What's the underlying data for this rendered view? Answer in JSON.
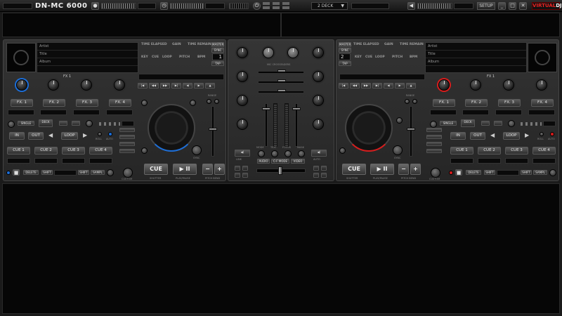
{
  "app": {
    "brand": "DN-MC 6000",
    "deck_select": "2 DECK",
    "setup_label": "SETUP",
    "logo_v": "VIRTUAL",
    "logo_d": "DJ"
  },
  "colors": {
    "left_accent": "#1c6ed8",
    "right_accent": "#d81c1c",
    "bg": "#1a1a1a"
  },
  "deck_left": {
    "track_fields": [
      "Artist",
      "Title",
      "Album"
    ],
    "headers": {
      "time_elapsed": "TIME ELAPSED",
      "gain": "GAIN",
      "time_remain": "TIME REMAIN"
    },
    "subheaders": {
      "key": "KEY",
      "cue": "CUE",
      "loop": "LOOP",
      "pitch": "PITCH",
      "bpm": "BPM"
    },
    "master_label": "MASTER",
    "sync_label": "SYNC",
    "tap_label": "TAP",
    "deck_number": "1",
    "fx_title": "FX 1",
    "fx_buttons": [
      "FX. 1",
      "FX. 2",
      "FX. 3",
      "FX. 4"
    ],
    "single_label": "SINGLE",
    "deck_label": "DECK",
    "in_label": "IN",
    "out_label": "OUT",
    "loop_label": "LOOP",
    "cue_buttons": [
      "CUE 1",
      "CUE 2",
      "CUE 3",
      "CUE 4"
    ],
    "cue_label": "CUE",
    "play_label": "▶ II",
    "shutter_label": "SHUTTER",
    "playpause_label": "PLAY/PAUSE",
    "pitch_bend_label": "PITCH BEND",
    "custom_label": "CUSTOM",
    "range_label": "RANGE",
    "sync_btn": "SYNC",
    "roll_label": "ROLL",
    "auto_label": "AUTO",
    "delete_label": "DELETE",
    "shift_label": "SHIFT",
    "samp_label": "SAMPL"
  },
  "deck_right": {
    "track_fields": [
      "Artist",
      "Title",
      "Album"
    ],
    "headers": {
      "time_elapsed": "TIME ELAPSED",
      "gain": "GAIN",
      "time_remain": "TIME REMAIN"
    },
    "subheaders": {
      "key": "KEY",
      "cue": "CUE",
      "loop": "LOOP",
      "pitch": "PITCH",
      "bpm": "BPM"
    },
    "master_label": "MASTER",
    "sync_label": "SYNC",
    "tap_label": "TAP",
    "deck_number": "2",
    "fx_title": "FX 1",
    "fx_buttons": [
      "FX. 1",
      "FX. 2",
      "FX. 3",
      "FX. 4"
    ],
    "single_label": "SINGLE",
    "deck_label": "DECK",
    "in_label": "IN",
    "out_label": "OUT",
    "loop_label": "LOOP",
    "cue_buttons": [
      "CUE 1",
      "CUE 2",
      "CUE 3",
      "CUE 4"
    ],
    "cue_label": "CUE",
    "play_label": "▶ II",
    "shutter_label": "SHUTTER",
    "playpause_label": "PLAY/PAUSE",
    "pitch_bend_label": "PITCH BEND",
    "custom_label": "CUSTOM",
    "range_label": "RANGE",
    "sync_btn": "SYNC",
    "roll_label": "ROLL",
    "auto_label": "AUTO",
    "delete_label": "DELETE",
    "shift_label": "SHIFT",
    "samp_label": "SAMPL"
  },
  "mixer": {
    "mic_label": "MIC CROSSFADERS",
    "mode_labels": [
      "MODE",
      "TEXT",
      "FOCUS",
      "MASK"
    ],
    "mode_buttons": [
      "AUDIO",
      "C-F MODE",
      "VIDEO"
    ],
    "link_label": "LINK",
    "auto_label": "AUTO",
    "knob_labels": [
      "MIN",
      "MAX"
    ]
  }
}
